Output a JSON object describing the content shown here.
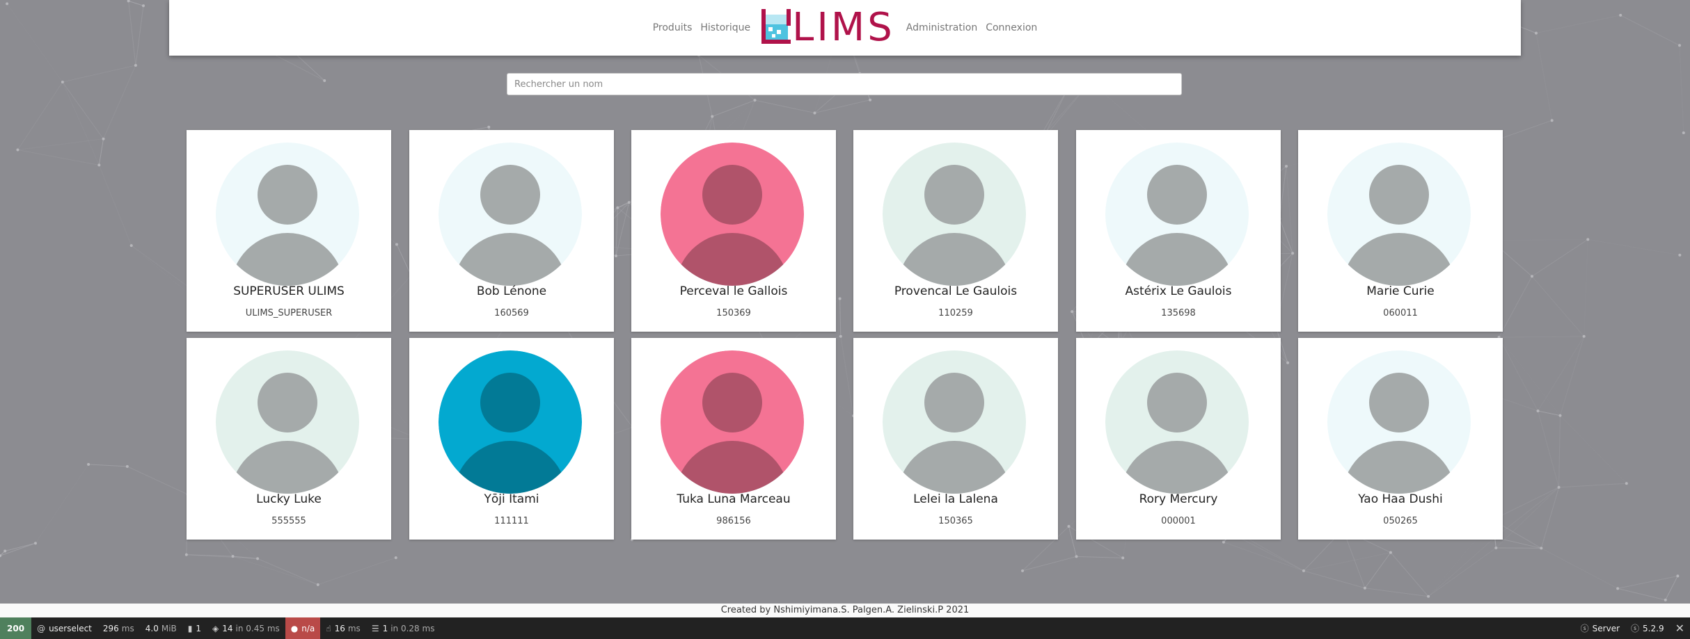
{
  "nav": {
    "left_links": [
      "Produits",
      "Historique"
    ],
    "brand": "LIMS",
    "right_links": [
      "Administration",
      "Connexion"
    ]
  },
  "search": {
    "placeholder": "Rechercher un nom",
    "value": ""
  },
  "users": [
    {
      "name": "SUPERUSER ULIMS",
      "id": "ULIMS_SUPERUSER",
      "color": "#eef9fb"
    },
    {
      "name": "Bob Lénone",
      "id": "160569",
      "color": "#eef9fb"
    },
    {
      "name": "Perceval le Gallois",
      "id": "150369",
      "color": "#f47394"
    },
    {
      "name": "Provencal Le Gaulois",
      "id": "110259",
      "color": "#e3f1ec"
    },
    {
      "name": "Astérix Le Gaulois",
      "id": "135698",
      "color": "#eef9fb"
    },
    {
      "name": "Marie Curie",
      "id": "060011",
      "color": "#eef9fb"
    },
    {
      "name": "Lucky Luke",
      "id": "555555",
      "color": "#e3f1ec"
    },
    {
      "name": "Yōji Itami",
      "id": "111111",
      "color": "#03a9d0"
    },
    {
      "name": "Tuka Luna Marceau",
      "id": "986156",
      "color": "#f47394"
    },
    {
      "name": "Lelei la Lalena",
      "id": "150365",
      "color": "#e3f1ec"
    },
    {
      "name": "Rory Mercury",
      "id": "000001",
      "color": "#e3f1ec"
    },
    {
      "name": "Yao Haa Dushi",
      "id": "050265",
      "color": "#eef9fb"
    }
  ],
  "footer": {
    "text": "Created by Nshimiyimana.S. Palgen.A. Zielinski.P 2021"
  },
  "toolbar": {
    "status_code": "200",
    "route": "userselect",
    "time_value": "296",
    "time_unit": "ms",
    "memory_value": "4.0",
    "memory_unit": "MiB",
    "logs": "1",
    "templates_value": "14",
    "templates_detail": "in 0.45 ms",
    "user": "n/a",
    "ajax_value": "16",
    "ajax_unit": "ms",
    "db_value": "1",
    "db_detail": "in 0.28 ms",
    "server_label": "Server",
    "version": "5.2.9"
  },
  "colors": {
    "brand": "#b0124a",
    "background": "#8c8c91",
    "status_ok": "#4f805d",
    "user_badge": "#b94a48"
  }
}
